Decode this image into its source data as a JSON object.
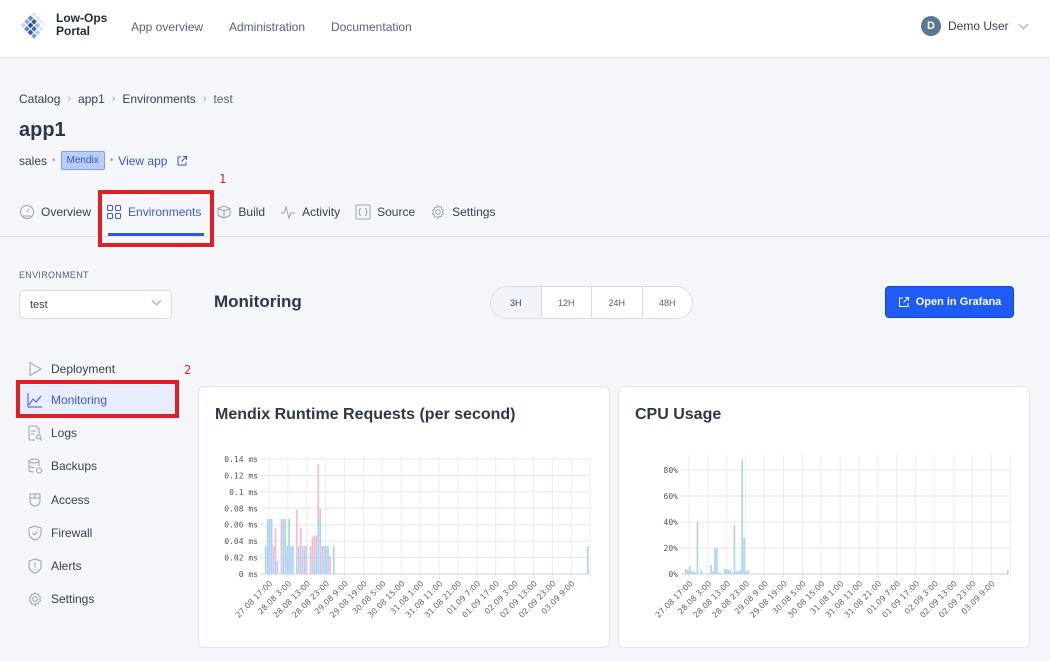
{
  "header": {
    "logo_text_line1": "Low-Ops",
    "logo_text_line2": "Portal",
    "nav": [
      "App overview",
      "Administration",
      "Documentation"
    ],
    "user": {
      "initial": "D",
      "name": "Demo User"
    }
  },
  "breadcrumb": [
    "Catalog",
    "app1",
    "Environments",
    "test"
  ],
  "app": {
    "title": "app1",
    "team": "sales",
    "badge": "Mendix",
    "view_app": "View app"
  },
  "tabs": [
    {
      "label": "Overview",
      "icon": "dashboard-gauge-icon",
      "active": false
    },
    {
      "label": "Environments",
      "icon": "grid-icon",
      "active": true
    },
    {
      "label": "Build",
      "icon": "box-icon",
      "active": false
    },
    {
      "label": "Activity",
      "icon": "activity-pulse-icon",
      "active": false
    },
    {
      "label": "Source",
      "icon": "code-braces-icon",
      "active": false
    },
    {
      "label": "Settings",
      "icon": "gear-icon",
      "active": false
    }
  ],
  "annotations": {
    "tab_marker": "1",
    "sidebar_marker": "2"
  },
  "environment": {
    "label": "ENVIRONMENT",
    "selected": "test"
  },
  "sidebar": {
    "items": [
      {
        "label": "Deployment",
        "icon": "play-icon",
        "active": false
      },
      {
        "label": "Monitoring",
        "icon": "line-chart-icon",
        "active": true
      },
      {
        "label": "Logs",
        "icon": "log-file-search-icon",
        "active": false
      },
      {
        "label": "Backups",
        "icon": "database-backup-icon",
        "active": false
      },
      {
        "label": "Access",
        "icon": "access-mouse-icon",
        "active": false
      },
      {
        "label": "Firewall",
        "icon": "shield-check-icon",
        "active": false
      },
      {
        "label": "Alerts",
        "icon": "shield-alert-icon",
        "active": false
      },
      {
        "label": "Settings",
        "icon": "gear-icon",
        "active": false
      }
    ]
  },
  "monitoring": {
    "title": "Monitoring",
    "ranges": [
      {
        "label": "3H",
        "active": true
      },
      {
        "label": "12H",
        "active": false
      },
      {
        "label": "24H",
        "active": false
      },
      {
        "label": "48H",
        "active": false
      }
    ],
    "grafana_button": "Open in Grafana"
  },
  "colors": {
    "accent": "#1f5cf5",
    "series_blue": "#a9d2f3",
    "series_pink": "#f7b8c8",
    "highlight_red": "#e01e25"
  },
  "chart_data": [
    {
      "type": "bar",
      "stacked": true,
      "title": "Mendix Runtime Requests (per second)",
      "xlabel": "",
      "ylabel": "",
      "ylim": [
        0,
        0.14
      ],
      "y_ticks": [
        "0 ms",
        "0.02 ms",
        "0.04 ms",
        "0.06 ms",
        "0.08 ms",
        "0.1 ms",
        "0.12 ms",
        "0.14 ms"
      ],
      "x_ticks": [
        "27.08 17:00",
        "28.08 3:00",
        "28.08 13:00",
        "28.08 23:00",
        "29.08 9:00",
        "29.08 19:00",
        "30.08 5:00",
        "30.08 15:00",
        "31.08 1:00",
        "31.08 11:00",
        "31.08 21:00",
        "01.09 7:00",
        "01.09 17:00",
        "02.09 3:00",
        "02.09 13:00",
        "02.09 23:00",
        "03.09 9:00"
      ],
      "grid": true,
      "legend": "none",
      "x_slots": 175,
      "series": [
        {
          "name": "series-a",
          "color": "#a9d2f3",
          "points": [
            [
              0,
              0.034
            ],
            [
              1,
              0.067
            ],
            [
              2,
              0.067
            ],
            [
              3,
              0.067
            ],
            [
              4,
              0.0
            ],
            [
              5,
              0.022
            ],
            [
              6,
              0.016
            ],
            [
              7,
              0.0
            ],
            [
              8,
              0.0
            ],
            [
              9,
              0.067
            ],
            [
              10,
              0.067
            ],
            [
              11,
              0.034
            ],
            [
              12,
              0.067
            ],
            [
              13,
              0.034
            ],
            [
              14,
              0.034
            ],
            [
              15,
              0.0
            ],
            [
              16,
              0.012
            ],
            [
              17,
              0.034
            ],
            [
              18,
              0.0
            ],
            [
              19,
              0.034
            ],
            [
              20,
              0.034
            ],
            [
              21,
              0.0
            ],
            [
              22,
              0.0
            ],
            [
              23,
              0.034
            ],
            [
              24,
              0.0
            ],
            [
              25,
              0.012
            ],
            [
              26,
              0.034
            ],
            [
              27,
              0.067
            ],
            [
              28,
              0.067
            ],
            [
              29,
              0.0
            ],
            [
              30,
              0.034
            ],
            [
              31,
              0.034
            ],
            [
              32,
              0.034
            ],
            [
              33,
              0.0
            ],
            [
              34,
              0.0
            ],
            [
              35,
              0.034
            ],
            [
              174,
              0.034
            ]
          ]
        },
        {
          "name": "series-b",
          "color": "#f7b8c8",
          "points": [
            [
              3,
              0.0
            ],
            [
              4,
              0.034
            ],
            [
              5,
              0.034
            ],
            [
              8,
              0.067
            ],
            [
              15,
              0.0
            ],
            [
              16,
              0.066
            ],
            [
              18,
              0.056
            ],
            [
              21,
              0.034
            ],
            [
              24,
              0.045
            ],
            [
              25,
              0.035
            ],
            [
              26,
              0.013
            ],
            [
              27,
              0.067
            ],
            [
              28,
              0.012
            ],
            [
              29,
              0.034
            ],
            [
              33,
              0.022
            ],
            [
              34,
              0.0
            ]
          ]
        }
      ]
    },
    {
      "type": "bar",
      "title": "CPU Usage",
      "xlabel": "",
      "ylabel": "",
      "ylim": [
        0,
        90
      ],
      "y_ticks": [
        "0%",
        "20%",
        "40%",
        "60%",
        "80%"
      ],
      "x_ticks": [
        "27.08 17:00",
        "28.08 3:00",
        "28.08 13:00",
        "28.08 23:00",
        "29.08 9:00",
        "29.08 19:00",
        "30.08 5:00",
        "30.08 15:00",
        "31.08 1:00",
        "31.08 11:00",
        "31.08 21:00",
        "01.09 7:00",
        "01.09 17:00",
        "02.09 3:00",
        "02.09 13:00",
        "02.09 23:00",
        "03.09 9:00"
      ],
      "grid": true,
      "legend": "none",
      "x_slots": 175,
      "series": [
        {
          "name": "cpu",
          "color": "#a9d2f3",
          "points": [
            [
              0,
              4
            ],
            [
              1,
              3
            ],
            [
              2,
              6
            ],
            [
              3,
              2
            ],
            [
              4,
              2
            ],
            [
              5,
              1
            ],
            [
              6,
              40
            ],
            [
              8,
              3
            ],
            [
              13,
              7
            ],
            [
              14,
              2
            ],
            [
              15,
              20
            ],
            [
              16,
              20
            ],
            [
              17,
              1
            ],
            [
              18,
              1
            ],
            [
              20,
              4
            ],
            [
              21,
              4
            ],
            [
              22,
              3
            ],
            [
              23,
              3
            ],
            [
              24,
              1
            ],
            [
              25,
              38
            ],
            [
              26,
              2
            ],
            [
              27,
              2
            ],
            [
              28,
              3
            ],
            [
              29,
              88
            ],
            [
              30,
              28
            ],
            [
              31,
              2
            ],
            [
              32,
              3
            ],
            [
              174,
              3
            ]
          ]
        }
      ]
    }
  ]
}
